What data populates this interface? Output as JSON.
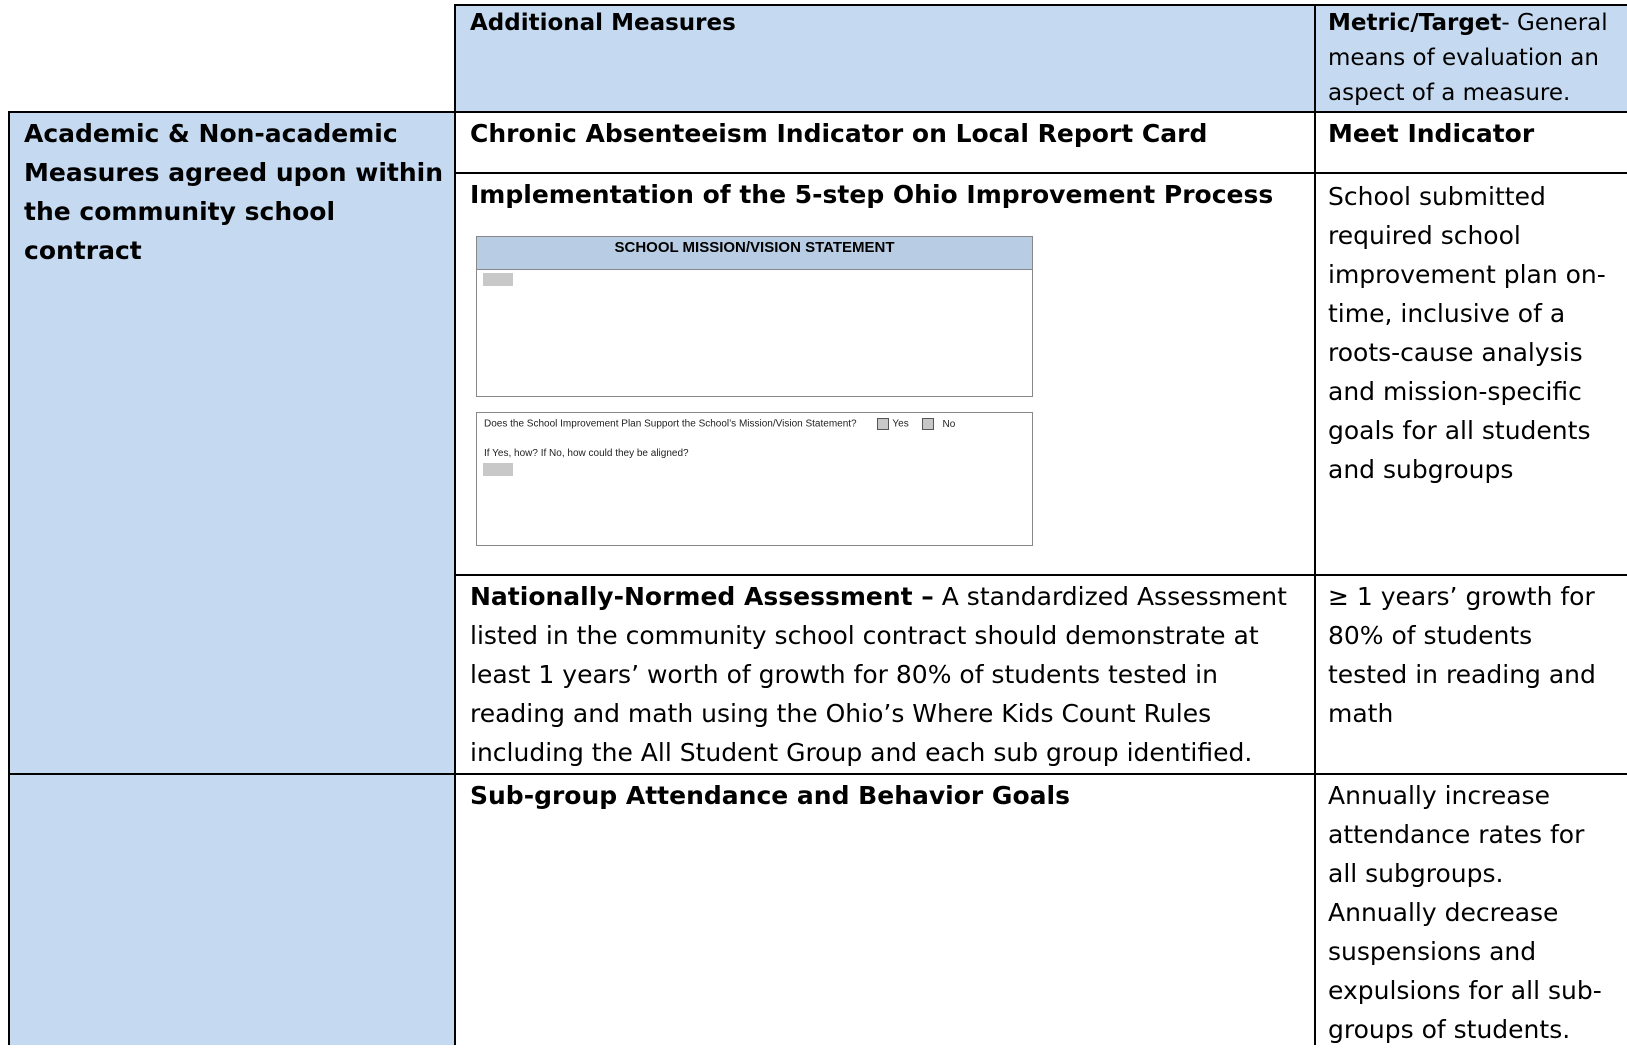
{
  "header": {
    "additional_measures": "Additional Measures",
    "metric_bold": "Metric/Target",
    "metric_rest": "- General means of evaluation an aspect of a measure."
  },
  "section1": {
    "label": "Academic & Non-academic Measures agreed upon within the community school contract",
    "rows": [
      {
        "measure": "Chronic Absenteeism Indicator on Local Report Card",
        "metric": "Meet Indicator"
      },
      {
        "measure": "Implementation of the 5-step Ohio Improvement Process",
        "metric": "School submitted required school improvement plan on-time, inclusive of a roots-cause analysis and mission-specific goals for all students and subgroups"
      },
      {
        "measure_bold": "Nationally-Normed Assessment –",
        "measure_rest": " A standardized Assessment listed in the community school contract should demonstrate at least 1 years’ worth of growth for 80% of students tested in reading and math using the Ohio’s Where Kids Count Rules including the All Student Group and each sub group identified.",
        "metric": "≥ 1 years’ growth for 80% of students tested in reading and math"
      }
    ]
  },
  "section2": {
    "label": "",
    "rows": [
      {
        "measure": "Sub-group Attendance and Behavior Goals",
        "metric": "Annually increase attendance rates for all subgroups. Annually decrease suspensions and expulsions for all sub-groups of students."
      }
    ]
  },
  "embedded_form": {
    "title": "SCHOOL MISSION/VISION STATEMENT",
    "question": "Does the School Improvement Plan Support the School’s Mission/Vision Statement?",
    "yes": "Yes",
    "no": "No",
    "followup": "If Yes, how? If No, how could they be aligned?"
  }
}
